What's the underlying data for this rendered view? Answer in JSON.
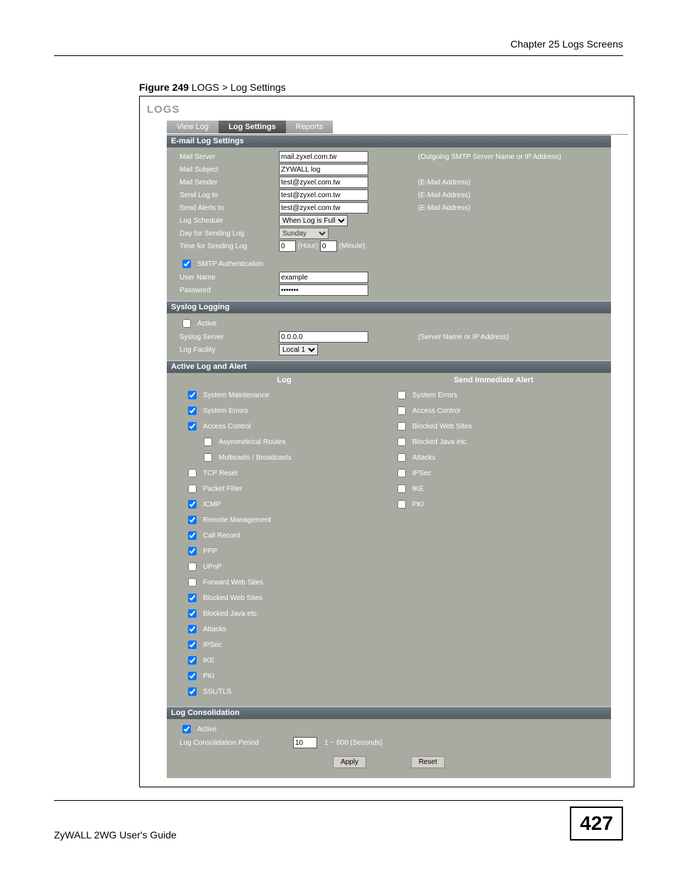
{
  "chapter_header": "Chapter 25 Logs Screens",
  "figure_caption_bold": "Figure 249",
  "figure_caption_rest": "   LOGS > Log Settings",
  "logs_title": "LOGS",
  "tabs": {
    "view_log": "View Log",
    "log_settings": "Log Settings",
    "reports": "Reports"
  },
  "sec1": {
    "title": "E-mail Log Settings",
    "mail_server_lbl": "Mail Server",
    "mail_server_val": "mail.zyxel.com.tw",
    "mail_server_hint": "(Outgoing SMTP Server Name or IP Address)",
    "mail_subject_lbl": "Mail Subject",
    "mail_subject_val": "ZYWALL log",
    "mail_sender_lbl": "Mail Sender",
    "mail_sender_val": "test@zyxel.com.tw",
    "mail_sender_hint": "(E-Mail Address)",
    "send_log_to_lbl": "Send Log to",
    "send_log_to_val": "test@zyxel.com.tw",
    "send_log_to_hint": "(E-Mail Address)",
    "send_alerts_to_lbl": "Send Alerts to",
    "send_alerts_to_val": "test@zyxel.com.tw",
    "send_alerts_to_hint": "(E-Mail Address)",
    "log_schedule_lbl": "Log Schedule",
    "log_schedule_val": "When Log is Full",
    "day_lbl": "Day for Sending Log",
    "day_val": "Sunday",
    "time_lbl": "Time for Sending Log",
    "hour_val": "0",
    "hour_unit": "(Hour)",
    "minute_val": "0",
    "minute_unit": "(Minute)",
    "smtp_auth_lbl": "SMTP Authentication",
    "username_lbl": "User Name",
    "username_val": "example",
    "password_lbl": "Password",
    "password_val": "•••••••"
  },
  "sec2": {
    "title": "Syslog Logging",
    "active_lbl": "Active",
    "server_lbl": "Syslog Server",
    "server_val": "0.0.0.0",
    "server_hint": "(Server Name or IP Address)",
    "facility_lbl": "Log Facility",
    "facility_val": "Local 1"
  },
  "sec3": {
    "title": "Active Log and Alert",
    "col_log": "Log",
    "col_alert": "Send Immediate Alert",
    "left": {
      "sys_maint": "System Maintenance",
      "sys_err": "System Errors",
      "access": "Access Control",
      "asym": "Asymmetrical Routes",
      "multi": "Multicasts / Broadcasts",
      "tcp_reset": "TCP Reset",
      "pkt_filter": "Packet Filter",
      "icmp": "ICMP",
      "remote": "Remote Management",
      "call": "Call Record",
      "ppp": "PPP",
      "upnp": "UPnP",
      "fwd": "Forward Web Sites",
      "blk_web": "Blocked Web Sites",
      "blk_java": "Blocked Java etc.",
      "attacks": "Attacks",
      "ipsec": "IPSec",
      "ike": "IKE",
      "pki": "PKI",
      "ssl": "SSL/TLS"
    },
    "right": {
      "sys_err": "System Errors",
      "access": "Access Control",
      "blk_web": "Blocked Web Sites",
      "blk_java": "Blocked Java etc.",
      "attacks": "Attacks",
      "ipsec": "IPSec",
      "ike": "IKE",
      "pki": "PKI"
    }
  },
  "sec4": {
    "title": "Log Consolidation",
    "active_lbl": "Active",
    "period_lbl": "Log Consolidation Period",
    "period_val": "10",
    "period_hint": "1 ~ 600 (Seconds)"
  },
  "buttons": {
    "apply": "Apply",
    "reset": "Reset"
  },
  "footer_guide": "ZyWALL 2WG User's Guide",
  "page_number": "427"
}
